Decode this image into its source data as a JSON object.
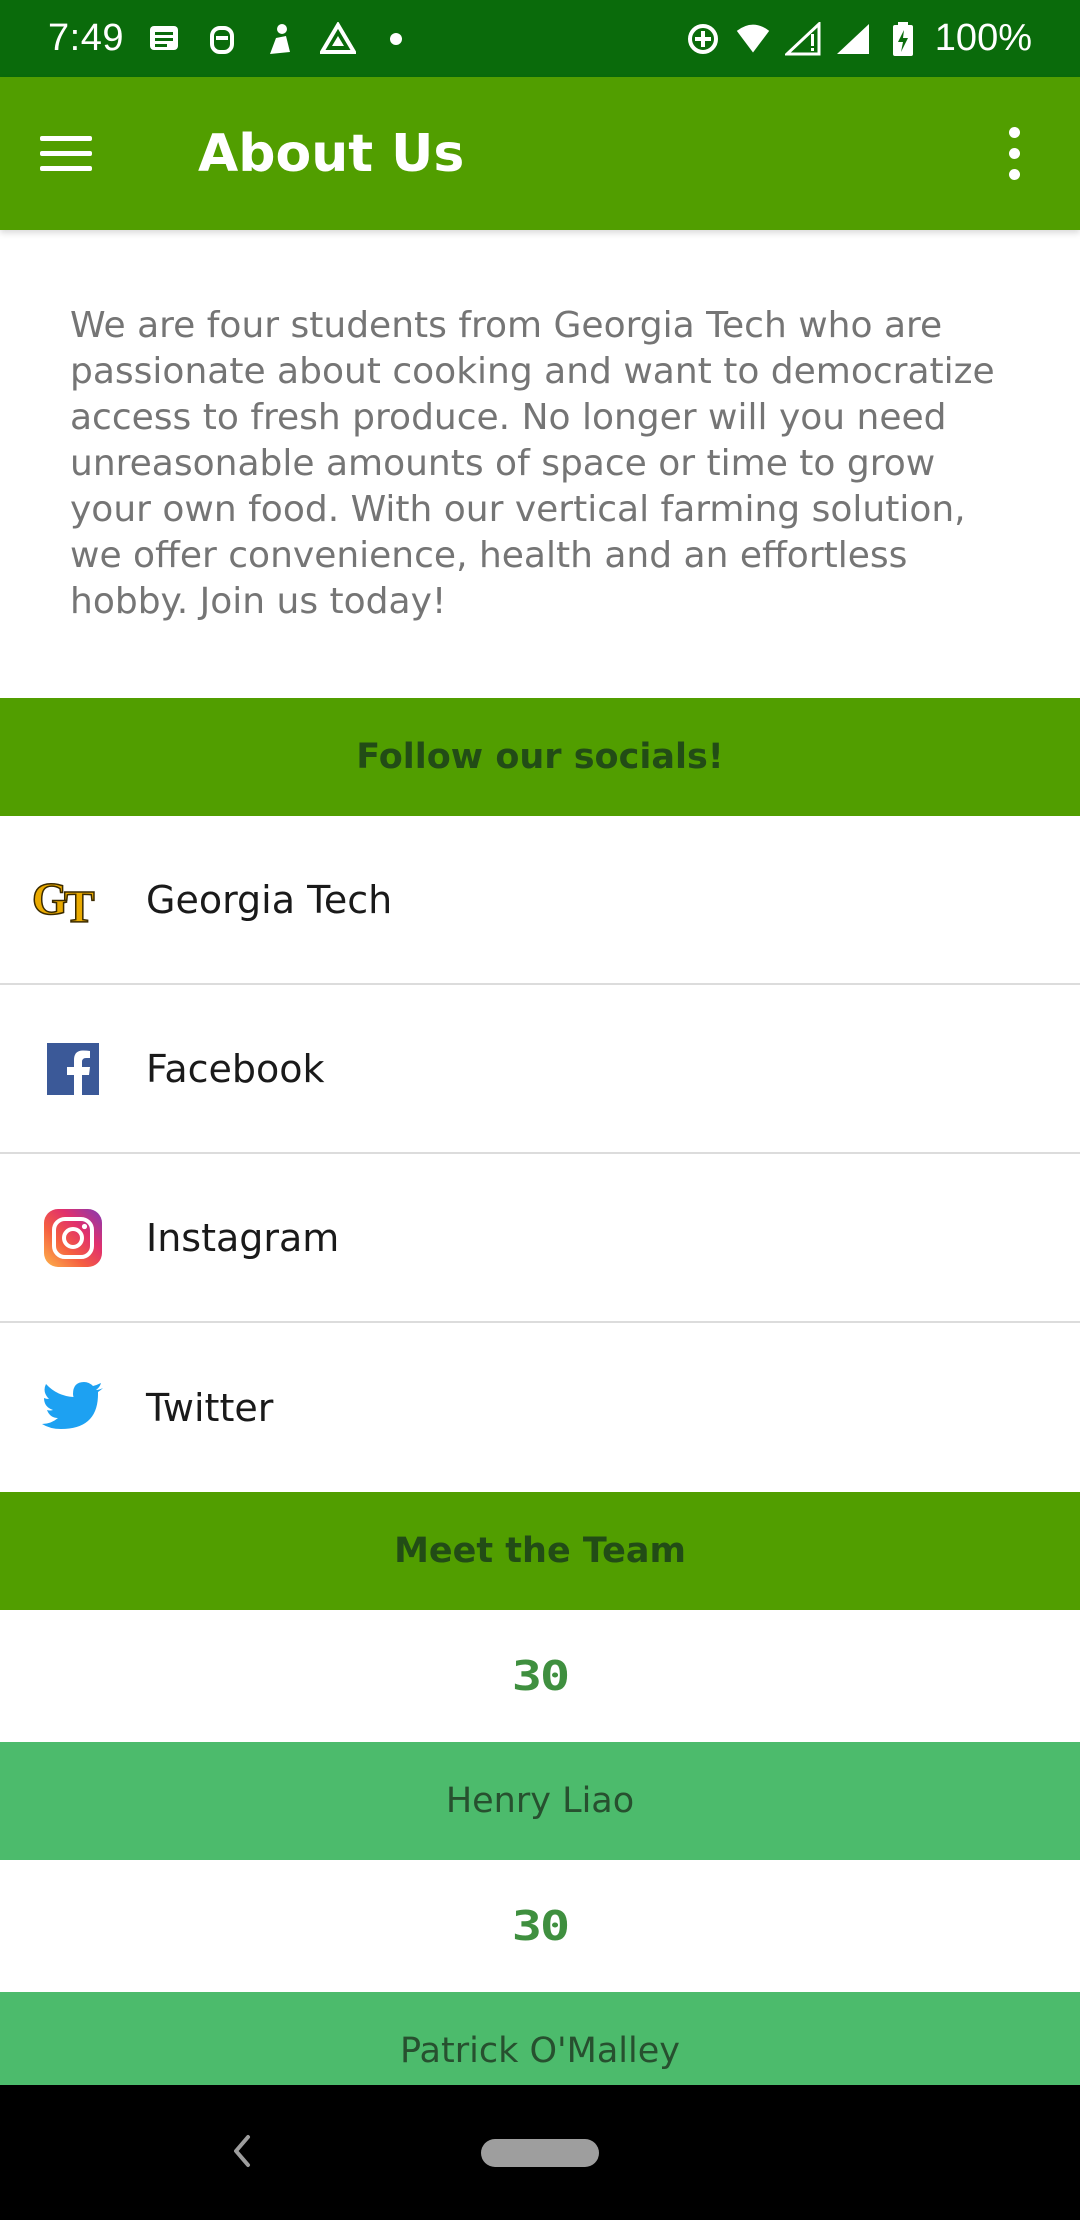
{
  "status_bar": {
    "time": "7:49",
    "battery": "100%",
    "background": "#0a6b0b"
  },
  "app_bar": {
    "title": "About Us",
    "background": "#519e00"
  },
  "about": {
    "text": "We are four students from Georgia Tech who are passionate about cooking and want to democratize access to fresh produce. No longer will you need unreasonable amounts of space or time to grow your own food. With our vertical farming solution, we offer convenience, health and an effortless hobby. Join us today!"
  },
  "socials": {
    "header": "Follow our socials!",
    "items": [
      {
        "label": "Georgia Tech",
        "icon": "georgia-tech-logo-icon"
      },
      {
        "label": "Facebook",
        "icon": "facebook-icon"
      },
      {
        "label": "Instagram",
        "icon": "instagram-icon"
      },
      {
        "label": "Twitter",
        "icon": "twitter-icon"
      }
    ]
  },
  "team": {
    "header": "Meet the Team",
    "members": [
      {
        "number": "30",
        "name": "Henry Liao"
      },
      {
        "number": "30",
        "name": "Patrick O'Malley"
      }
    ],
    "name_background": "#4cbb6c"
  }
}
